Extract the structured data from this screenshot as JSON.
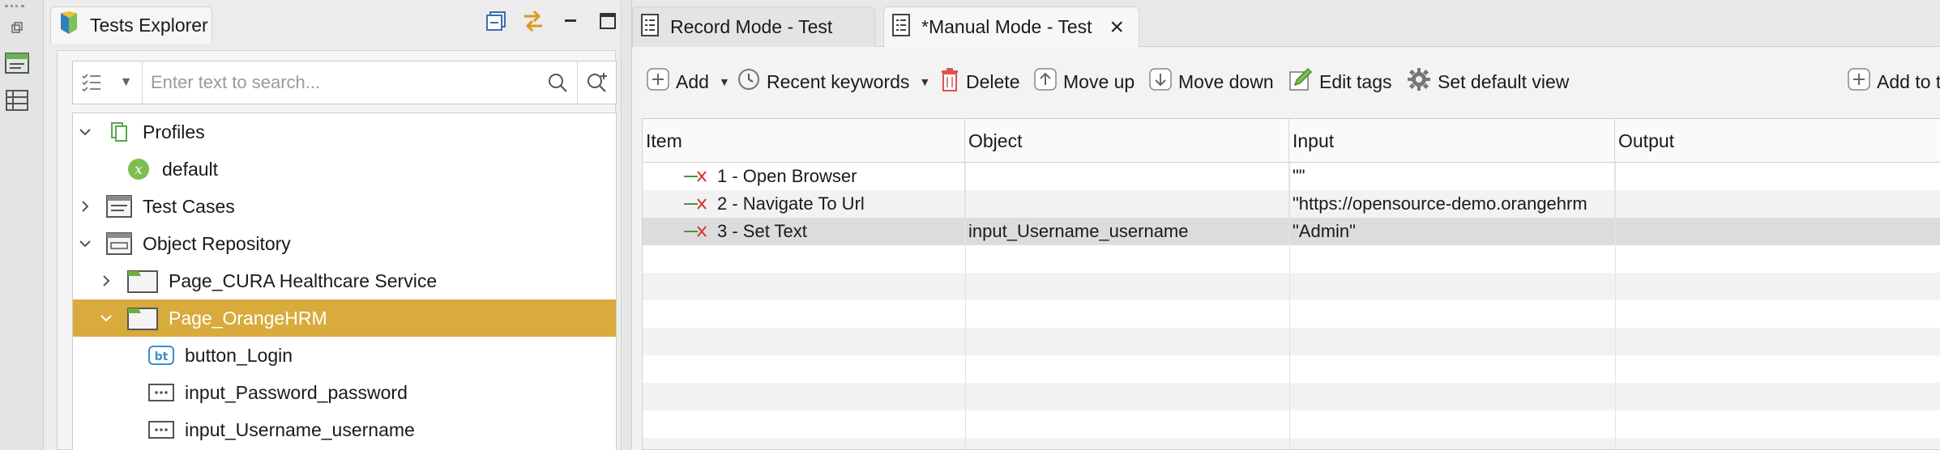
{
  "left_panel": {
    "tab_title": "Tests Explorer",
    "search_placeholder": "Enter text to search...",
    "tree": [
      {
        "label": "Profiles",
        "icon": "profiles-icon",
        "expanded": true
      },
      {
        "label": "default",
        "icon": "profile-variable-icon"
      },
      {
        "label": "Test Cases",
        "icon": "test-cases-icon",
        "expanded": false
      },
      {
        "label": "Object Repository",
        "icon": "object-repository-icon",
        "expanded": true
      },
      {
        "label": "Page_CURA Healthcare Service",
        "icon": "folder-icon",
        "expanded": false
      },
      {
        "label": "Page_OrangeHRM",
        "icon": "folder-icon",
        "expanded": true,
        "selected": true
      },
      {
        "label": "button_Login",
        "icon": "button-object-icon",
        "badge": "bt"
      },
      {
        "label": "input_Password_password",
        "icon": "input-object-icon"
      },
      {
        "label": "input_Username_username",
        "icon": "input-object-icon"
      }
    ]
  },
  "editor": {
    "tabs": [
      {
        "label": "Record Mode - Test",
        "active": false
      },
      {
        "label": "*Manual Mode - Test",
        "active": true
      }
    ],
    "toolbar": {
      "add": "Add",
      "recent_keywords": "Recent keywords",
      "delete": "Delete",
      "move_up": "Move up",
      "move_down": "Move down",
      "edit_tags": "Edit tags",
      "set_default_view": "Set default view",
      "add_to": "Add to t"
    },
    "table": {
      "columns": [
        "Item",
        "Object",
        "Input",
        "Output"
      ],
      "rows": [
        {
          "item": "1 - Open Browser",
          "object": "",
          "input": "\"\"",
          "output": ""
        },
        {
          "item": "2 - Navigate To Url",
          "object": "",
          "input": "\"https://opensource-demo.orangehrm",
          "output": ""
        },
        {
          "item": "3 - Set Text",
          "object": "input_Username_username",
          "input": "\"Admin\"",
          "output": "",
          "selected": true
        }
      ]
    }
  },
  "colors": {
    "selection": "#d9ab3c",
    "keyword_green": "#3e9b3e",
    "keyword_red": "#d9342b"
  }
}
